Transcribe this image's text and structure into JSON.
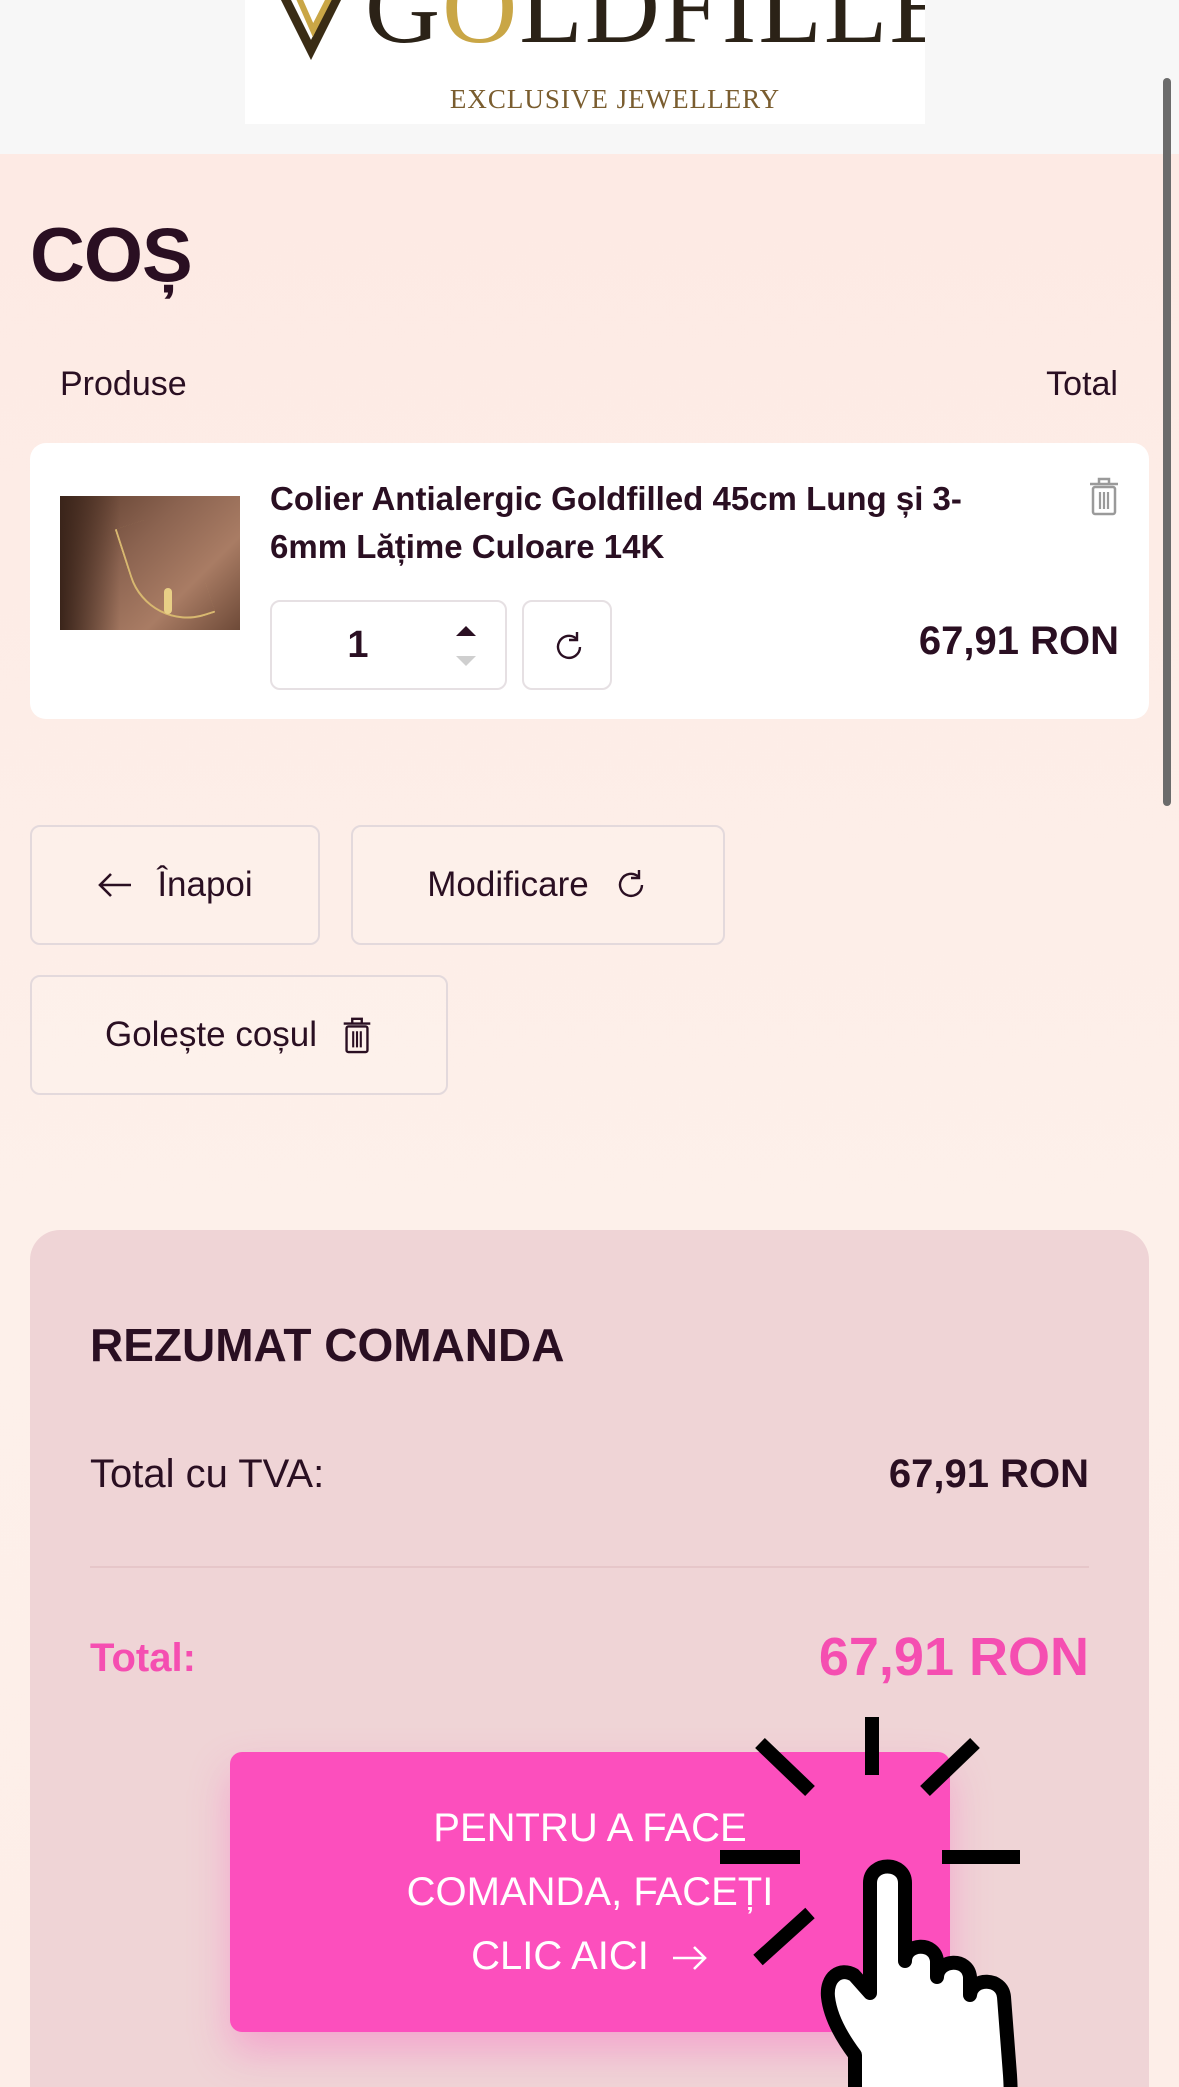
{
  "header": {
    "brand_prefix": "G",
    "brand_gold": "O",
    "brand_rest": "LDFILLED",
    "tagline": "EXCLUSIVE   JEWELLERY",
    "logo_icon": "gold-v-mark-icon"
  },
  "cart": {
    "title": "COȘ",
    "col_products": "Produse",
    "col_total": "Total",
    "item": {
      "name": "Colier Antialergic Goldfilled 45cm Lung și 3-6mm Lățime Culoare 14K",
      "quantity": "1",
      "price": "67,91 RON"
    }
  },
  "actions": {
    "back_label": "Înapoi",
    "update_label": "Modificare",
    "empty_label": "Golește coșul"
  },
  "summary": {
    "title": "REZUMAT COMANDA",
    "subtotal_label": "Total cu TVA:",
    "subtotal_value": "67,91 RON",
    "total_label": "Total:",
    "total_value": "67,91 RON",
    "order_line1": "PENTRU A FACE",
    "order_line2": "COMANDA, FACEȚI",
    "order_line3": "CLIC AICI"
  },
  "colors": {
    "accent": "#fc4fbd",
    "total_text": "#f54eb1",
    "summary_bg": "#efd4d6",
    "text": "#2a0f22"
  }
}
